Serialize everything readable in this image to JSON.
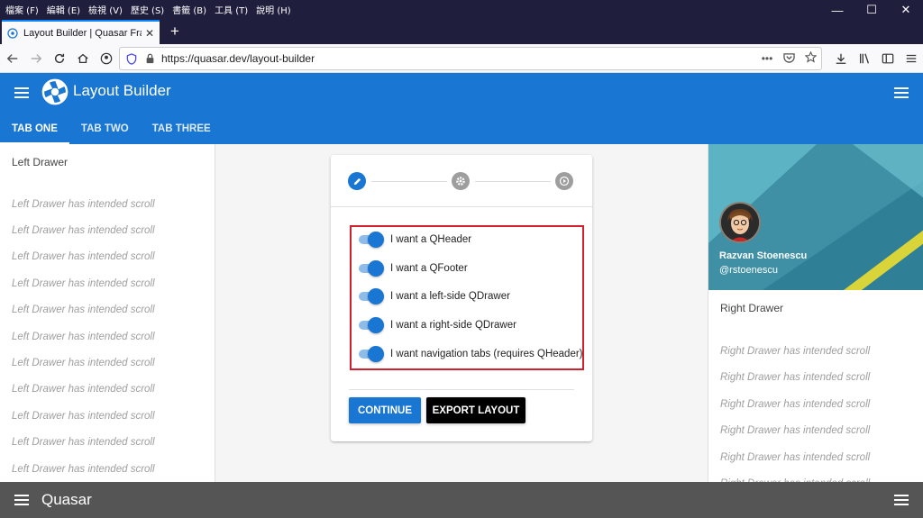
{
  "window": {
    "menus": [
      "檔案 (F)",
      "編輯 (E)",
      "檢視 (V)",
      "歷史 (S)",
      "書籤 (B)",
      "工具 (T)",
      "說明 (H)"
    ],
    "controls": {
      "minimize": "—",
      "maximize": "☐",
      "close": "✕"
    }
  },
  "browser": {
    "tab_title": "Layout Builder | Quasar Framework",
    "tab_close": "✕",
    "new_tab": "+",
    "url": "https://quasar.dev/layout-builder",
    "more": "•••"
  },
  "app": {
    "title": "Layout Builder",
    "tabs": [
      {
        "label": "Tab One",
        "active": true
      },
      {
        "label": "Tab Two",
        "active": false
      },
      {
        "label": "Tab Three",
        "active": false
      }
    ],
    "accent": "#1976d2"
  },
  "left_drawer": {
    "title": "Left Drawer",
    "lines": [
      "Left Drawer has intended scroll",
      "Left Drawer has intended scroll",
      "Left Drawer has intended scroll",
      "Left Drawer has intended scroll",
      "Left Drawer has intended scroll",
      "Left Drawer has intended scroll",
      "Left Drawer has intended scroll",
      "Left Drawer has intended scroll",
      "Left Drawer has intended scroll",
      "Left Drawer has intended scroll",
      "Left Drawer has intended scroll"
    ]
  },
  "right_drawer": {
    "profile_name": "Razvan Stoenescu",
    "profile_handle": "@rstoenescu",
    "title": "Right Drawer",
    "lines": [
      "Right Drawer has intended scroll",
      "Right Drawer has intended scroll",
      "Right Drawer has intended scroll",
      "Right Drawer has intended scroll",
      "Right Drawer has intended scroll",
      "Right Drawer has intended scroll"
    ]
  },
  "stepper": {
    "steps": [
      {
        "icon": "pencil-icon",
        "active": true
      },
      {
        "icon": "gear-icon",
        "active": false
      },
      {
        "icon": "play-circle-icon",
        "active": false
      }
    ],
    "options": [
      {
        "label": "I want a QHeader",
        "checked": true
      },
      {
        "label": "I want a QFooter",
        "checked": true
      },
      {
        "label": "I want a left-side QDrawer",
        "checked": true
      },
      {
        "label": "I want a right-side QDrawer",
        "checked": true
      },
      {
        "label": "I want navigation tabs (requires QHeader)",
        "checked": true
      }
    ],
    "continue_label": "Continue",
    "export_label": "Export Layout"
  },
  "footer": {
    "title": "Quasar"
  }
}
